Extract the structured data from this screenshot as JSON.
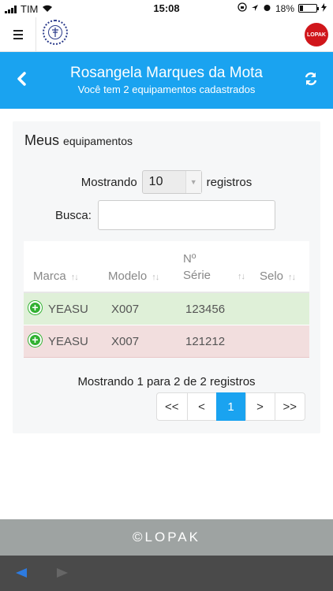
{
  "status": {
    "carrier": "TIM",
    "time": "15:08",
    "battery": "18%"
  },
  "header": {
    "title": "Rosangela Marques da Mota",
    "subtitle": "Você tem 2 equipamentos cadastrados"
  },
  "card": {
    "title_main": "Meus",
    "title_small": "equipamentos",
    "length_prefix": "Mostrando",
    "length_value": "10",
    "length_suffix": "registros",
    "search_label": "Busca:",
    "columns": {
      "marca": "Marca",
      "modelo": "Modelo",
      "serie_line1": "Nº",
      "serie_line2": "Série",
      "selo": "Selo"
    },
    "rows": [
      {
        "marca": "YEASU",
        "modelo": "X007",
        "serie": "123456",
        "selo": ""
      },
      {
        "marca": "YEASU",
        "modelo": "X007",
        "serie": "121212",
        "selo": ""
      }
    ],
    "info": "Mostrando 1 para 2 de 2 registros",
    "pager": {
      "first": "<<",
      "prev": "<",
      "page": "1",
      "next": ">",
      "last": ">>"
    }
  },
  "footer": {
    "brand": "©LOPAK"
  },
  "badge": {
    "text": "LOPAK"
  },
  "colors": {
    "accent": "#1aa3f0",
    "row_ok": "#dff0d8",
    "row_bad": "#f2dede",
    "brand_red": "#d0161b"
  }
}
